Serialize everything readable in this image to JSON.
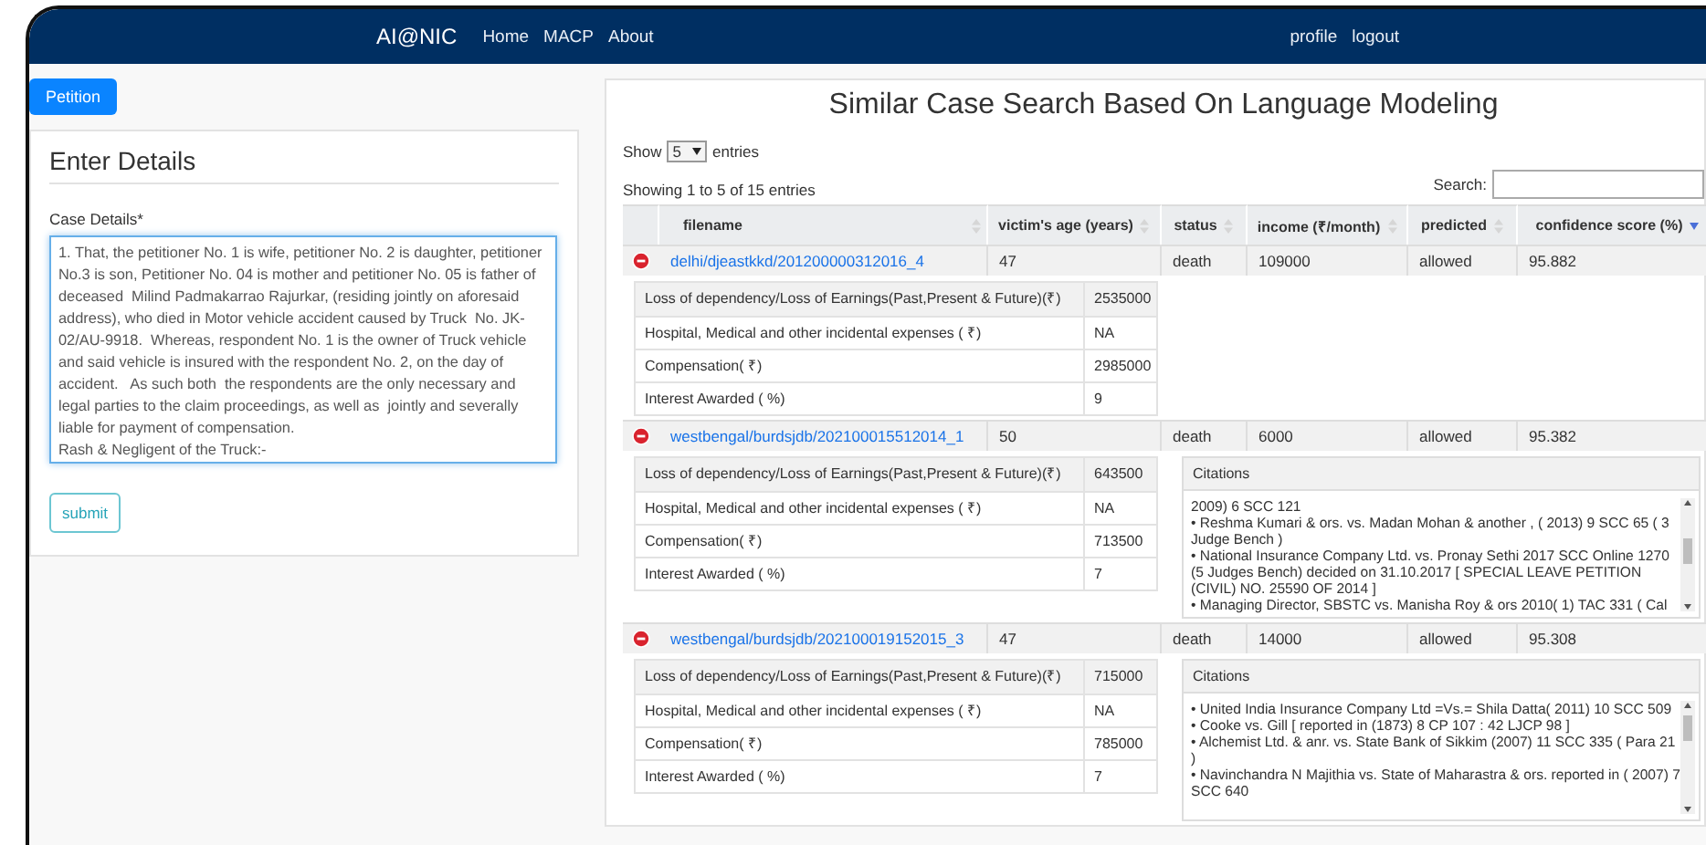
{
  "navbar": {
    "brand": "AI@NIC",
    "links": [
      "Home",
      "MACP",
      "About"
    ],
    "right_links": [
      "profile",
      "logout"
    ]
  },
  "petition_button": "Petition",
  "form": {
    "title": "Enter Details",
    "label": "Case Details*",
    "case_details": "1. That, the petitioner No. 1 is wife, petitioner No. 2 is daughter, petitioner No.3 is son, Petitioner No. 04 is mother and petitioner No. 05 is father of deceased  Milind Padmakarrao Rajurkar, (residing jointly on aforesaid address), who died in Motor vehicle accident caused by Truck  No. JK-02/AU-9918.  Whereas, respondent No. 1 is the owner of Truck vehicle and said vehicle is insured with the respondent No. 2, on the day of accident.   As such both  the respondents are the only necessary and legal parties to the claim proceedings, as well as  jointly and severally liable for payment of compensation.\nRash & Negligent of the Truck:-",
    "submit": "submit"
  },
  "results": {
    "title": "Similar Case Search Based On Language Modeling",
    "show_label": "Show",
    "page_size": "5",
    "entries_label": "entries",
    "info": "Showing 1 to 5 of 15 entries",
    "search_label": "Search:",
    "columns": [
      {
        "label": "filename",
        "sorted": false
      },
      {
        "label": "victim's age (years)",
        "sorted": false
      },
      {
        "label": "status",
        "sorted": false
      },
      {
        "label": "income (₹/month)",
        "sorted": false
      },
      {
        "label": "predicted",
        "sorted": false
      },
      {
        "label": "confidence score (%)",
        "sorted": true
      }
    ],
    "rows": [
      {
        "expanded": true,
        "filename": "delhi/djeastkkd/201200000312016_4",
        "age": "47",
        "status": "death",
        "income": "109000",
        "predicted": "allowed",
        "confidence": "95.882",
        "details": [
          [
            "Loss of dependency/Loss of Earnings(Past,Present & Future)(₹)",
            "2535000"
          ],
          [
            "Hospital, Medical and other incidental expenses ( ₹)",
            "NA"
          ],
          [
            "Compensation( ₹)",
            "2985000"
          ],
          [
            "Interest Awarded ( %)",
            "9"
          ]
        ]
      },
      {
        "expanded": true,
        "filename": "westbengal/burdsjdb/202100015512014_1",
        "age": "50",
        "status": "death",
        "income": "6000",
        "predicted": "allowed",
        "confidence": "95.382",
        "details": [
          [
            "Loss of dependency/Loss of Earnings(Past,Present & Future)(₹)",
            "643500"
          ],
          [
            "Hospital, Medical and other incidental expenses ( ₹)",
            "NA"
          ],
          [
            "Compensation( ₹)",
            "713500"
          ],
          [
            "Interest Awarded ( %)",
            "7"
          ]
        ],
        "citations_title": "Citations",
        "citations": [
          "2009) 6 SCC 121",
          "• Reshma Kumari & ors. vs. Madan Mohan & another , ( 2013) 9 SCC 65 ( 3 Judge Bench )",
          "• National Insurance Company Ltd. vs. Pronay Sethi 2017 SCC Online 1270 (5 Judges Bench) decided on 31.10.2017 [ SPECIAL LEAVE PETITION (CIVIL) NO. 25590 OF 2014 ]",
          "• Managing Director, SBSTC vs. Manisha Roy & ors 2010( 1) TAC 331 ( Cal"
        ]
      },
      {
        "expanded": true,
        "filename": "westbengal/burdsjdb/202100019152015_3",
        "age": "47",
        "status": "death",
        "income": "14000",
        "predicted": "allowed",
        "confidence": "95.308",
        "details": [
          [
            "Loss of dependency/Loss of Earnings(Past,Present & Future)(₹)",
            "715000"
          ],
          [
            "Hospital, Medical and other incidental expenses ( ₹)",
            "NA"
          ],
          [
            "Compensation( ₹)",
            "785000"
          ],
          [
            "Interest Awarded ( %)",
            "7"
          ]
        ],
        "citations_title": "Citations",
        "citations": [
          "• United India Insurance Company Ltd =Vs.= Shila Datta( 2011) 10 SCC 509",
          "• Cooke vs. Gill [ reported in (1873) 8 CP 107 : 42 LJCP 98 ]",
          "• Alchemist Ltd. & anr. vs. State Bank of Sikkim (2007) 11 SCC 335 ( Para 21 )",
          "• Navinchandra N Majithia vs. State of Maharastra & ors. reported in ( 2007) 7 SCC 640"
        ]
      }
    ]
  }
}
